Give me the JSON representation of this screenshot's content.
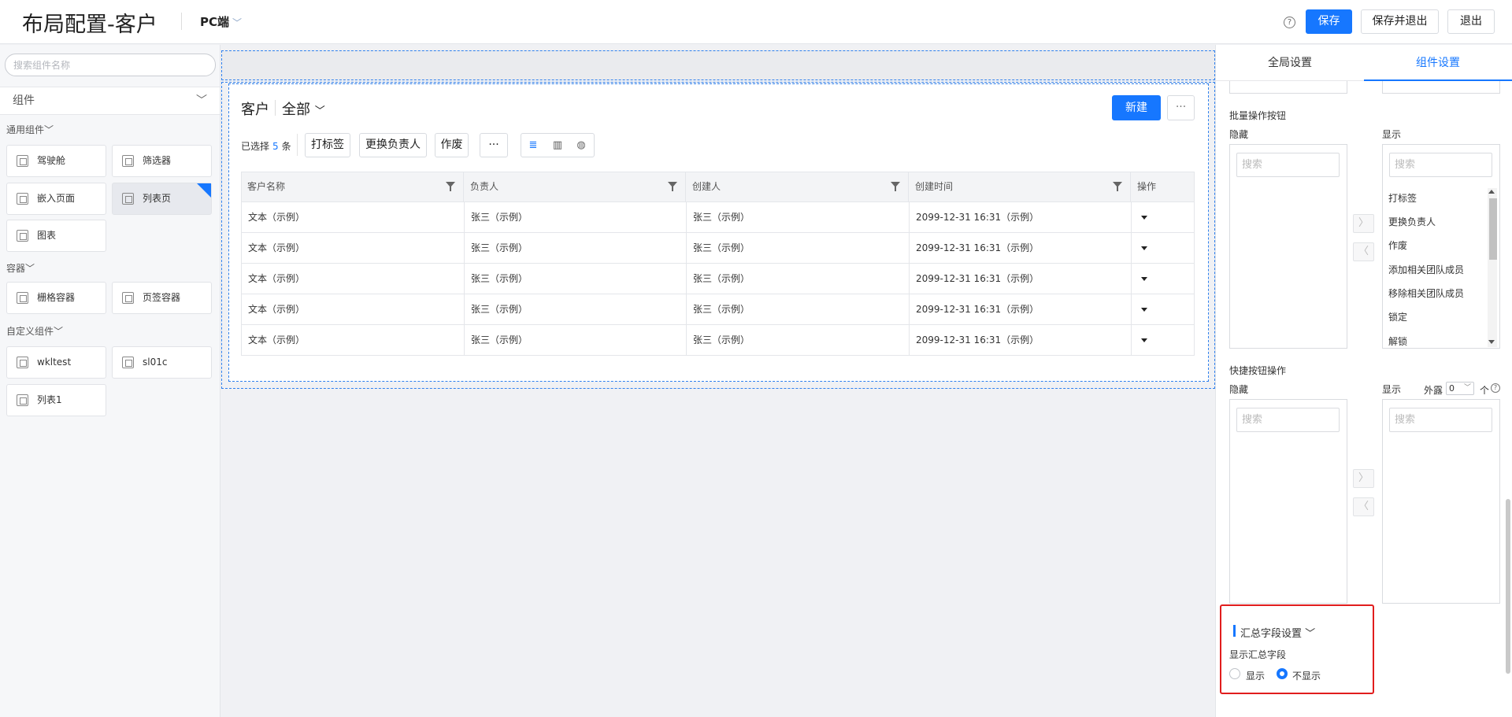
{
  "header": {
    "title": "布局配置-客户",
    "platform": "PC端",
    "save_label": "保存",
    "save_exit_label": "保存并退出",
    "exit_label": "退出"
  },
  "left_panel": {
    "search_placeholder": "搜索组件名称",
    "component_select": "组件",
    "groups": [
      {
        "title": "通用组件",
        "items": [
          "驾驶舱",
          "筛选器",
          "嵌入页面",
          "列表页",
          "图表"
        ]
      },
      {
        "title": "容器",
        "items": [
          "栅格容器",
          "页签容器"
        ]
      },
      {
        "title": "自定义组件",
        "items": [
          "wkltest",
          "sl01c",
          "列表1"
        ]
      }
    ]
  },
  "list_widget": {
    "object": "客户",
    "view": "全部",
    "new_label": "新建",
    "more_label": "···",
    "selected_prefix": "已选择",
    "selected_count": "5",
    "selected_suffix": "条",
    "actions": [
      "打标签",
      "更换负责人",
      "作废",
      "···"
    ],
    "columns": [
      "客户名称",
      "负责人",
      "创建人",
      "创建时间",
      "操作"
    ],
    "rows": [
      [
        "文本（示例）",
        "张三（示例）",
        "张三（示例）",
        "2099-12-31 16:31（示例）"
      ],
      [
        "文本（示例）",
        "张三（示例）",
        "张三（示例）",
        "2099-12-31 16:31（示例）"
      ],
      [
        "文本（示例）",
        "张三（示例）",
        "张三（示例）",
        "2099-12-31 16:31（示例）"
      ],
      [
        "文本（示例）",
        "张三（示例）",
        "张三（示例）",
        "2099-12-31 16:31（示例）"
      ],
      [
        "文本（示例）",
        "张三（示例）",
        "张三（示例）",
        "2099-12-31 16:31（示例）"
      ]
    ]
  },
  "right_panel": {
    "tabs": [
      "全局设置",
      "组件设置"
    ],
    "active_tab": "组件设置",
    "batch": {
      "title": "批量操作按钮",
      "hidden_label": "隐藏",
      "shown_label": "显示",
      "search_placeholder": "搜索",
      "shown_items": [
        "打标签",
        "更换负责人",
        "作废",
        "添加相关团队成员",
        "移除相关团队成员",
        "锁定",
        "解锁"
      ]
    },
    "quick": {
      "title": "快捷按钮操作",
      "hidden_label": "隐藏",
      "shown_label": "显示",
      "expose_label": "外露",
      "expose_value": "0",
      "expose_unit": "个",
      "search_placeholder": "搜索"
    },
    "summary": {
      "title": "汇总字段设置",
      "field_label": "显示汇总字段",
      "option_show": "显示",
      "option_hide": "不显示",
      "selected": "不显示"
    }
  },
  "colors": {
    "accent": "#1677ff",
    "highlight": "#e11d1d"
  }
}
